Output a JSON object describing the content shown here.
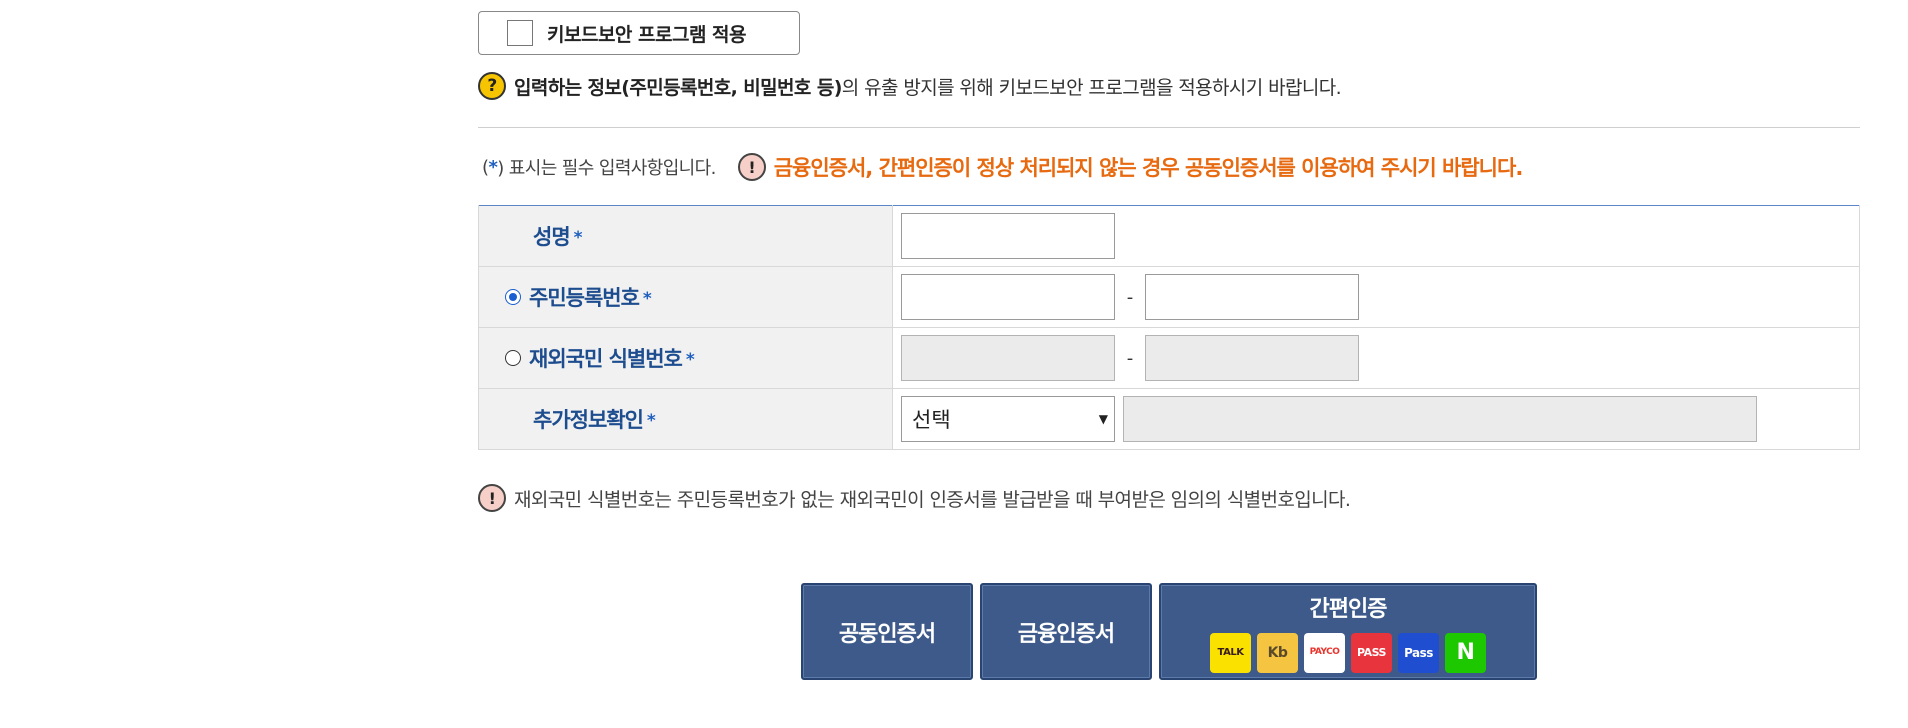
{
  "keyboard_security": {
    "label": "키보드보안 프로그램 적용"
  },
  "help": {
    "bold_part": "입력하는 정보(주민등록번호, 비밀번호 등)",
    "rest": "의 유출 방지를 위해 키보드보안 프로그램을 적용하시기 바랍니다."
  },
  "required_note": {
    "open": "(",
    "star": "*",
    "close": ") 표시는 필수 입력사항입니다.",
    "warning": "금융인증서, 간편인증이 정상 처리되지 않는 경우 공동인증서를 이용하여 주시기 바랍니다."
  },
  "form": {
    "name_label": "성명",
    "rrn_label": "주민등록번호",
    "foreign_label": "재외국민 식별번호",
    "extra_label": "추가정보확인",
    "star": "*",
    "dash": "-",
    "select_value": "선택",
    "select_arrow": "▼"
  },
  "note": {
    "text": "재외국민 식별번호는 주민등록번호가 없는 재외국민이 인증서를 발급받을 때 부여받은 임의의 식별번호입니다."
  },
  "buttons": {
    "joint_cert": "공동인증서",
    "financial_cert": "금융인증서",
    "simple_auth": "간편인증"
  },
  "logos": {
    "kakao": "TALK",
    "kb": "Kb",
    "payco": "PAYCO",
    "pass": "PASS",
    "samsung": "Pass",
    "naver": "N"
  },
  "icons": {
    "help": "?",
    "warn": "!"
  },
  "colors": {
    "accent_blue": "#1e4d8f",
    "button_blue": "#3d5a8a",
    "warning_orange": "#e86a10",
    "help_yellow": "#f6c400"
  }
}
